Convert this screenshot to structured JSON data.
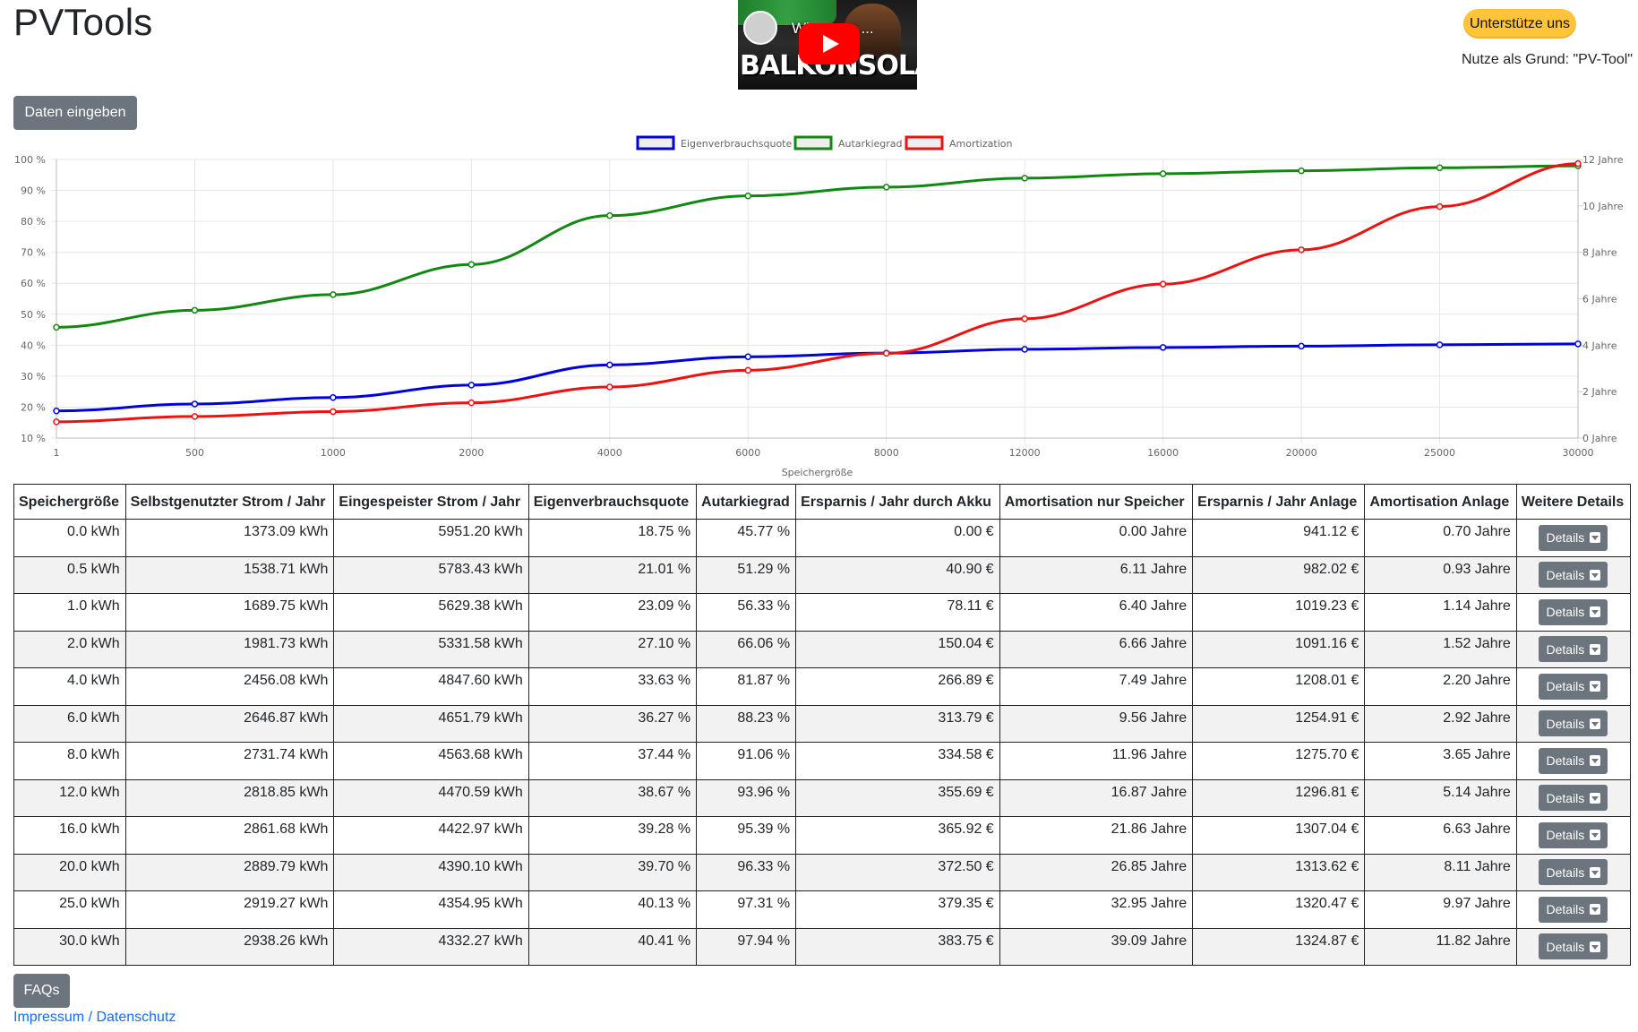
{
  "header": {
    "title": "PVTools",
    "support_label": "Unterstütze uns",
    "reason": "Nutze als Grund: \"PV-Tool\""
  },
  "video": {
    "title": "Wi... pare ...",
    "banner": "BALKONSOLAR"
  },
  "enter_button": "Daten eingeben",
  "chart_data": {
    "type": "line",
    "x": [
      "1",
      "500",
      "1000",
      "2000",
      "4000",
      "6000",
      "8000",
      "12000",
      "16000",
      "20000",
      "25000",
      "30000"
    ],
    "xlabel": "Speichergröße",
    "y_left": {
      "ticks": [
        "100 %",
        "90 %",
        "80 %",
        "70 %",
        "60 %",
        "50 %",
        "40 %",
        "30 %",
        "20 %",
        "10 %"
      ],
      "range": [
        10,
        100
      ],
      "unit": "%"
    },
    "y_right": {
      "ticks": [
        "12 Jahre",
        "10 Jahre",
        "8 Jahre",
        "6 Jahre",
        "4 Jahre",
        "2 Jahre",
        "0 Jahre"
      ],
      "range": [
        0,
        12
      ],
      "unit": "Jahre"
    },
    "legend_position": "top-center",
    "grid": true,
    "series": [
      {
        "name": "Eigenverbrauchsquote",
        "axis": "left",
        "color": "#0000dd",
        "values": [
          18.75,
          21.01,
          23.09,
          27.1,
          33.63,
          36.27,
          37.44,
          38.67,
          39.28,
          39.7,
          40.13,
          40.41
        ]
      },
      {
        "name": "Autarkiegrad",
        "axis": "left",
        "color": "#118811",
        "values": [
          45.77,
          51.29,
          56.33,
          66.06,
          81.87,
          88.23,
          91.06,
          93.96,
          95.39,
          96.33,
          97.31,
          97.94
        ]
      },
      {
        "name": "Amortization",
        "axis": "right",
        "color": "#ee1111",
        "values": [
          0.7,
          0.93,
          1.14,
          1.52,
          2.2,
          2.92,
          3.65,
          5.14,
          6.63,
          8.11,
          9.97,
          11.82
        ]
      }
    ]
  },
  "table": {
    "headers": [
      "Speichergröße",
      "Selbstgenutzter Strom / Jahr",
      "Eingespeister Strom / Jahr",
      "Eigenverbrauchsquote",
      "Autarkiegrad",
      "Ersparnis / Jahr durch Akku",
      "Amortisation nur Speicher",
      "Ersparnis / Jahr Anlage",
      "Amortisation Anlage",
      "Weitere Details"
    ],
    "details_label": "Details",
    "rows": [
      [
        "0.0 kWh",
        "1373.09 kWh",
        "5951.20 kWh",
        "18.75 %",
        "45.77 %",
        "0.00 €",
        "0.00 Jahre",
        "941.12 €",
        "0.70 Jahre"
      ],
      [
        "0.5 kWh",
        "1538.71 kWh",
        "5783.43 kWh",
        "21.01 %",
        "51.29 %",
        "40.90 €",
        "6.11 Jahre",
        "982.02 €",
        "0.93 Jahre"
      ],
      [
        "1.0 kWh",
        "1689.75 kWh",
        "5629.38 kWh",
        "23.09 %",
        "56.33 %",
        "78.11 €",
        "6.40 Jahre",
        "1019.23 €",
        "1.14 Jahre"
      ],
      [
        "2.0 kWh",
        "1981.73 kWh",
        "5331.58 kWh",
        "27.10 %",
        "66.06 %",
        "150.04 €",
        "6.66 Jahre",
        "1091.16 €",
        "1.52 Jahre"
      ],
      [
        "4.0 kWh",
        "2456.08 kWh",
        "4847.60 kWh",
        "33.63 %",
        "81.87 %",
        "266.89 €",
        "7.49 Jahre",
        "1208.01 €",
        "2.20 Jahre"
      ],
      [
        "6.0 kWh",
        "2646.87 kWh",
        "4651.79 kWh",
        "36.27 %",
        "88.23 %",
        "313.79 €",
        "9.56 Jahre",
        "1254.91 €",
        "2.92 Jahre"
      ],
      [
        "8.0 kWh",
        "2731.74 kWh",
        "4563.68 kWh",
        "37.44 %",
        "91.06 %",
        "334.58 €",
        "11.96 Jahre",
        "1275.70 €",
        "3.65 Jahre"
      ],
      [
        "12.0 kWh",
        "2818.85 kWh",
        "4470.59 kWh",
        "38.67 %",
        "93.96 %",
        "355.69 €",
        "16.87 Jahre",
        "1296.81 €",
        "5.14 Jahre"
      ],
      [
        "16.0 kWh",
        "2861.68 kWh",
        "4422.97 kWh",
        "39.28 %",
        "95.39 %",
        "365.92 €",
        "21.86 Jahre",
        "1307.04 €",
        "6.63 Jahre"
      ],
      [
        "20.0 kWh",
        "2889.79 kWh",
        "4390.10 kWh",
        "39.70 %",
        "96.33 %",
        "372.50 €",
        "26.85 Jahre",
        "1313.62 €",
        "8.11 Jahre"
      ],
      [
        "25.0 kWh",
        "2919.27 kWh",
        "4354.95 kWh",
        "40.13 %",
        "97.31 %",
        "379.35 €",
        "32.95 Jahre",
        "1320.47 €",
        "9.97 Jahre"
      ],
      [
        "30.0 kWh",
        "2938.26 kWh",
        "4332.27 kWh",
        "40.41 %",
        "97.94 %",
        "383.75 €",
        "39.09 Jahre",
        "1324.87 €",
        "11.82 Jahre"
      ]
    ]
  },
  "faq_label": "FAQs",
  "footer_link": "Impressum / Datenschutz"
}
